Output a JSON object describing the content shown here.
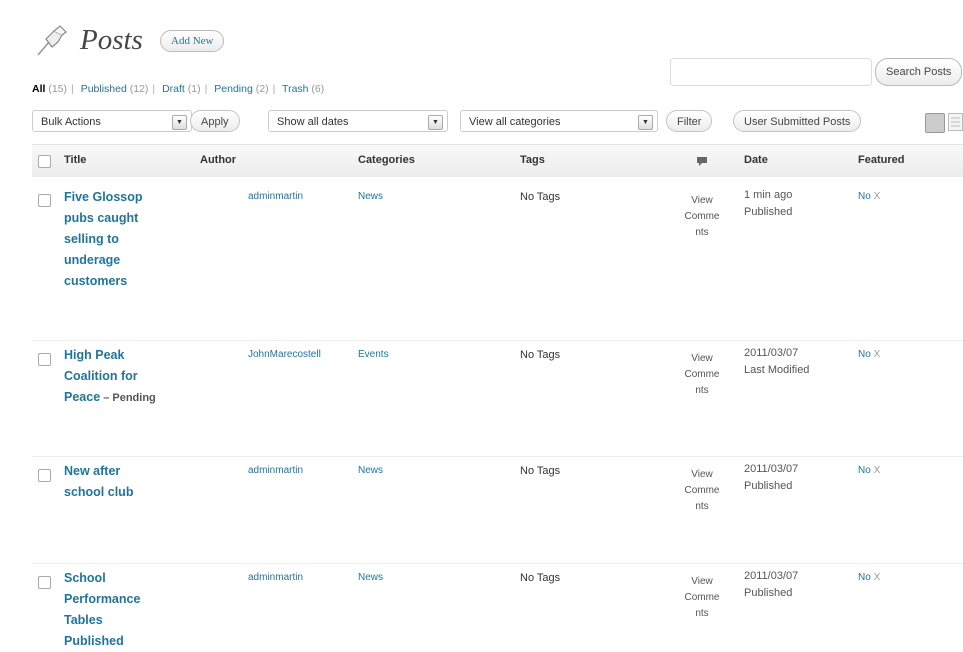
{
  "header": {
    "title": "Posts",
    "add_new_label": "Add New",
    "icon": "pushpin-icon"
  },
  "filters": {
    "views": [
      {
        "label": "All",
        "count": "(15)"
      },
      {
        "label": "Published",
        "count": "(12)"
      },
      {
        "label": "Draft",
        "count": "(1)"
      },
      {
        "label": "Pending",
        "count": "(2)"
      },
      {
        "label": "Trash",
        "count": "(6)"
      }
    ],
    "search_button_label": "Search Posts",
    "search_placeholder": "",
    "bulk_actions_value": "Bulk Actions",
    "apply_label": "Apply",
    "dates_value": "Show all dates",
    "categories_value": "View all categories",
    "filter_label": "Filter",
    "user_submitted_label": "User Submitted Posts"
  },
  "table": {
    "columns": {
      "title": "Title",
      "author": "Author",
      "categories": "Categories",
      "tags": "Tags",
      "comments_icon": "comment-bubble-icon",
      "date": "Date",
      "featured": "Featured"
    },
    "rows": [
      {
        "title_lines": [
          "Five Glossop",
          "pubs caught",
          "selling to",
          "underage",
          "customers"
        ],
        "state": "",
        "author": "adminmartin",
        "category": "News",
        "tags": "No Tags",
        "comments": [
          "View",
          "Comme",
          "nts"
        ],
        "date": "1 min ago",
        "status": "Published",
        "featured": "No",
        "featured_x": "X"
      },
      {
        "title_lines": [
          "High Peak",
          "Coalition for",
          "Peace"
        ],
        "state": " – Pending",
        "author": "JohnMarecostell",
        "category": "Events",
        "tags": "No Tags",
        "comments": [
          "View",
          "Comme",
          "nts"
        ],
        "date": "2011/03/07",
        "status": "Last Modified",
        "featured": "No",
        "featured_x": "X"
      },
      {
        "title_lines": [
          "New after",
          "school club"
        ],
        "state": "",
        "author": "adminmartin",
        "category": "News",
        "tags": "No Tags",
        "comments": [
          "View",
          "Comme",
          "nts"
        ],
        "date": "2011/03/07",
        "status": "Published",
        "featured": "No",
        "featured_x": "X"
      },
      {
        "title_lines": [
          "School",
          "Performance",
          "Tables",
          "Published"
        ],
        "state": "",
        "author": "adminmartin",
        "category": "News",
        "tags": "No Tags",
        "comments": [
          "View",
          "Comme",
          "nts"
        ],
        "date": "2011/03/07",
        "status": "Published",
        "featured": "No",
        "featured_x": "X"
      }
    ]
  },
  "colors": {
    "link": "#21759b",
    "header_bg": "#ececec",
    "text": "#333333"
  }
}
